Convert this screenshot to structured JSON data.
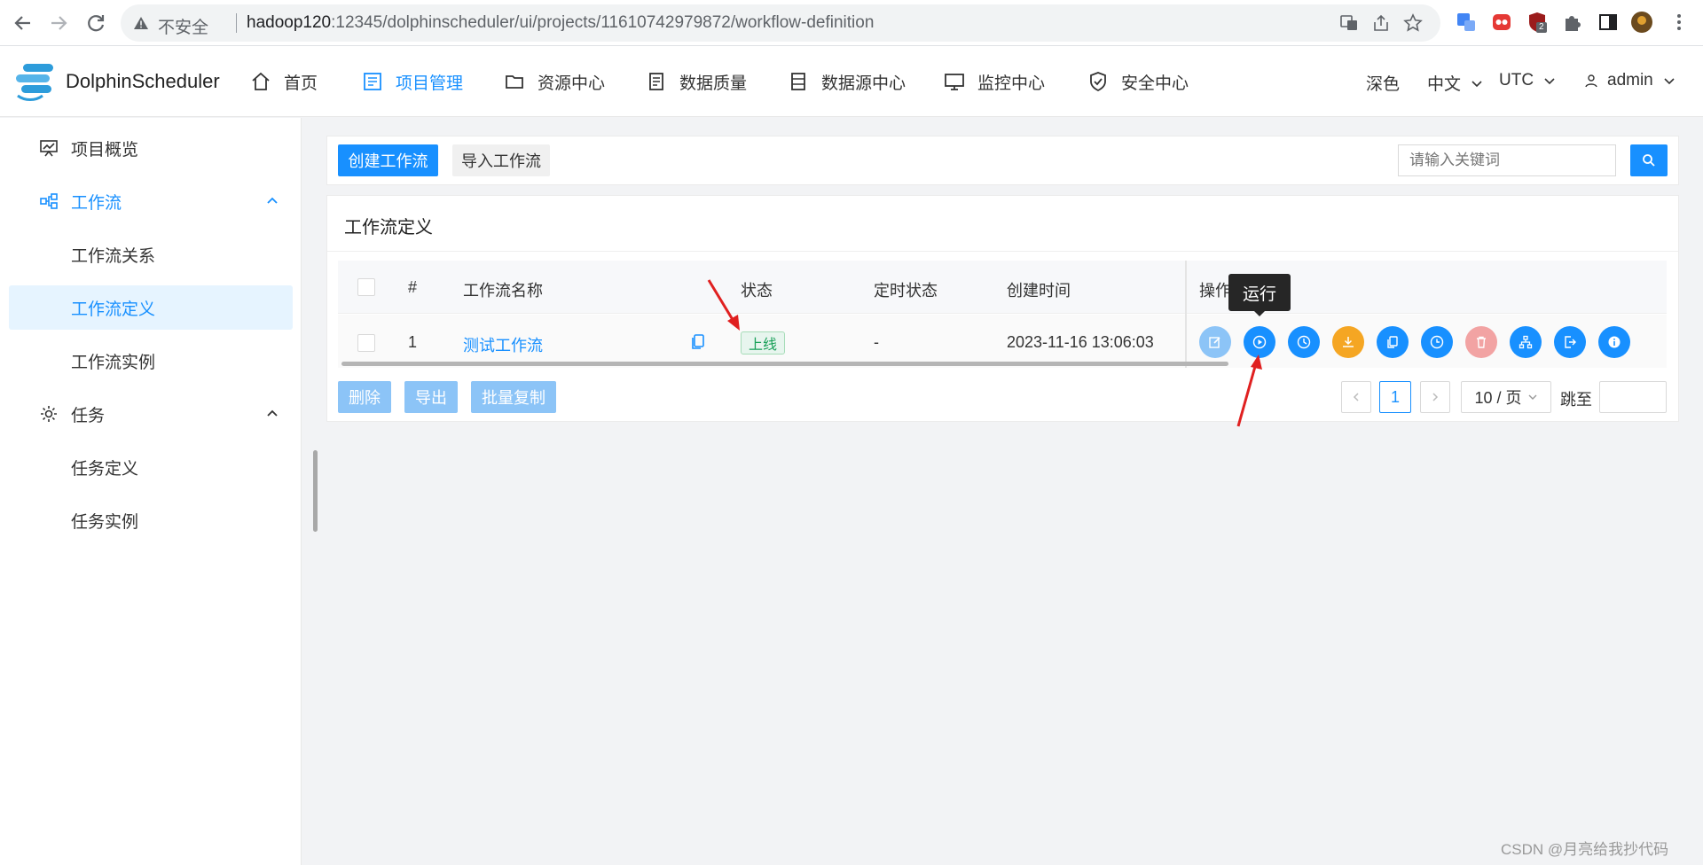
{
  "browser": {
    "security_label": "不安全",
    "url_host": "hadoop120",
    "url_rest": ":12345/dolphinscheduler/ui/projects/11610742979872/workflow-definition",
    "extension_badge": "2"
  },
  "header": {
    "logo_text": "DolphinScheduler",
    "menu": [
      {
        "label": "首页",
        "icon": "home-icon"
      },
      {
        "label": "项目管理",
        "icon": "project-icon"
      },
      {
        "label": "资源中心",
        "icon": "folder-icon"
      },
      {
        "label": "数据质量",
        "icon": "data-quality-icon"
      },
      {
        "label": "数据源中心",
        "icon": "datasource-icon"
      },
      {
        "label": "监控中心",
        "icon": "monitor-icon"
      },
      {
        "label": "安全中心",
        "icon": "shield-icon"
      }
    ],
    "theme": "深色",
    "language": "中文",
    "timezone": "UTC",
    "user": "admin"
  },
  "sidebar": {
    "items": [
      {
        "label": "项目概览"
      },
      {
        "label": "工作流"
      },
      {
        "label": "工作流关系"
      },
      {
        "label": "工作流定义"
      },
      {
        "label": "工作流实例"
      },
      {
        "label": "任务"
      },
      {
        "label": "任务定义"
      },
      {
        "label": "任务实例"
      }
    ]
  },
  "toolbar": {
    "create_label": "创建工作流",
    "import_label": "导入工作流",
    "search_placeholder": "请输入关键词"
  },
  "card": {
    "title": "工作流定义"
  },
  "table": {
    "headers": [
      "#",
      "工作流名称",
      "状态",
      "定时状态",
      "创建时间",
      "操作"
    ],
    "rows": [
      {
        "index": "1",
        "name": "测试工作流",
        "status": "上线",
        "schedule_status": "-",
        "created": "2023-11-16 13:06:03"
      }
    ]
  },
  "tooltip": "运行",
  "bulk": {
    "delete_label": "删除",
    "export_label": "导出",
    "copy_label": "批量复制"
  },
  "pagination": {
    "current_page": "1",
    "page_size": "10 / 页",
    "jump_label": "跳至"
  },
  "colors": {
    "primary": "#1890ff",
    "status_online": "#18a058",
    "op_orange": "#f5a623",
    "op_delete": "#f2a3a3",
    "annotation_arrow": "#e02020"
  },
  "watermark": "CSDN @月亮给我抄代码"
}
